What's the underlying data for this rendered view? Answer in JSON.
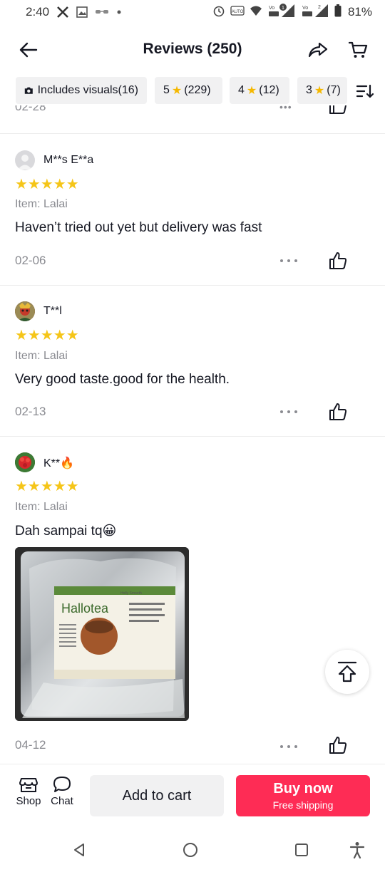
{
  "status_bar": {
    "time": "2:40",
    "battery": "81%",
    "icons": [
      "x-logo-icon",
      "image-icon",
      "glasses-icon",
      "dot-icon",
      "alarm-icon",
      "auto-icon",
      "wifi-icon",
      "volte-icon",
      "signal-icon",
      "battery-icon"
    ]
  },
  "header": {
    "title": "Reviews (250)",
    "icons": [
      "back-arrow-icon",
      "share-icon",
      "cart-icon"
    ]
  },
  "filters": {
    "chips": [
      {
        "label": "Includes visuals(16)",
        "icon": "camera-icon"
      },
      {
        "label_prefix": "5",
        "label_count": "(229)"
      },
      {
        "label_prefix": "4",
        "label_count": "(12)"
      },
      {
        "label_prefix": "3",
        "label_count": "(7)"
      }
    ],
    "sort_icon": "sort-icon"
  },
  "partial_review": {
    "date": "02-28"
  },
  "reviews": [
    {
      "user": "M**s E**a",
      "avatar": "default-avatar",
      "stars": "★★★★★",
      "rating": 5,
      "item": "Item: Lalai",
      "text": "Haven’t tried out yet but delivery was fast",
      "date": "02-06"
    },
    {
      "user": "T**l",
      "avatar": "character-avatar",
      "stars": "★★★★★",
      "rating": 5,
      "item": "Item: Lalai",
      "text": "Very good taste.good for the health.",
      "date": "02-13"
    },
    {
      "user": "K**🔥",
      "avatar": "flower-avatar",
      "stars": "★★★★★",
      "rating": 5,
      "item": "Item: Lalai",
      "text": "Dah sampai tq😀",
      "date": "04-12",
      "photo": {
        "brand_text": "Hallotea",
        "small_text": "Holly Smooth"
      }
    }
  ],
  "bottom_bar": {
    "shop_label": "Shop",
    "chat_label": "Chat",
    "add_to_cart": "Add to cart",
    "buy_now": "Buy now",
    "free_shipping": "Free shipping",
    "accent": "#fe2c55"
  },
  "colors": {
    "star": "#f5c518",
    "muted": "#8a8b91",
    "chip_bg": "#f1f1f2"
  }
}
